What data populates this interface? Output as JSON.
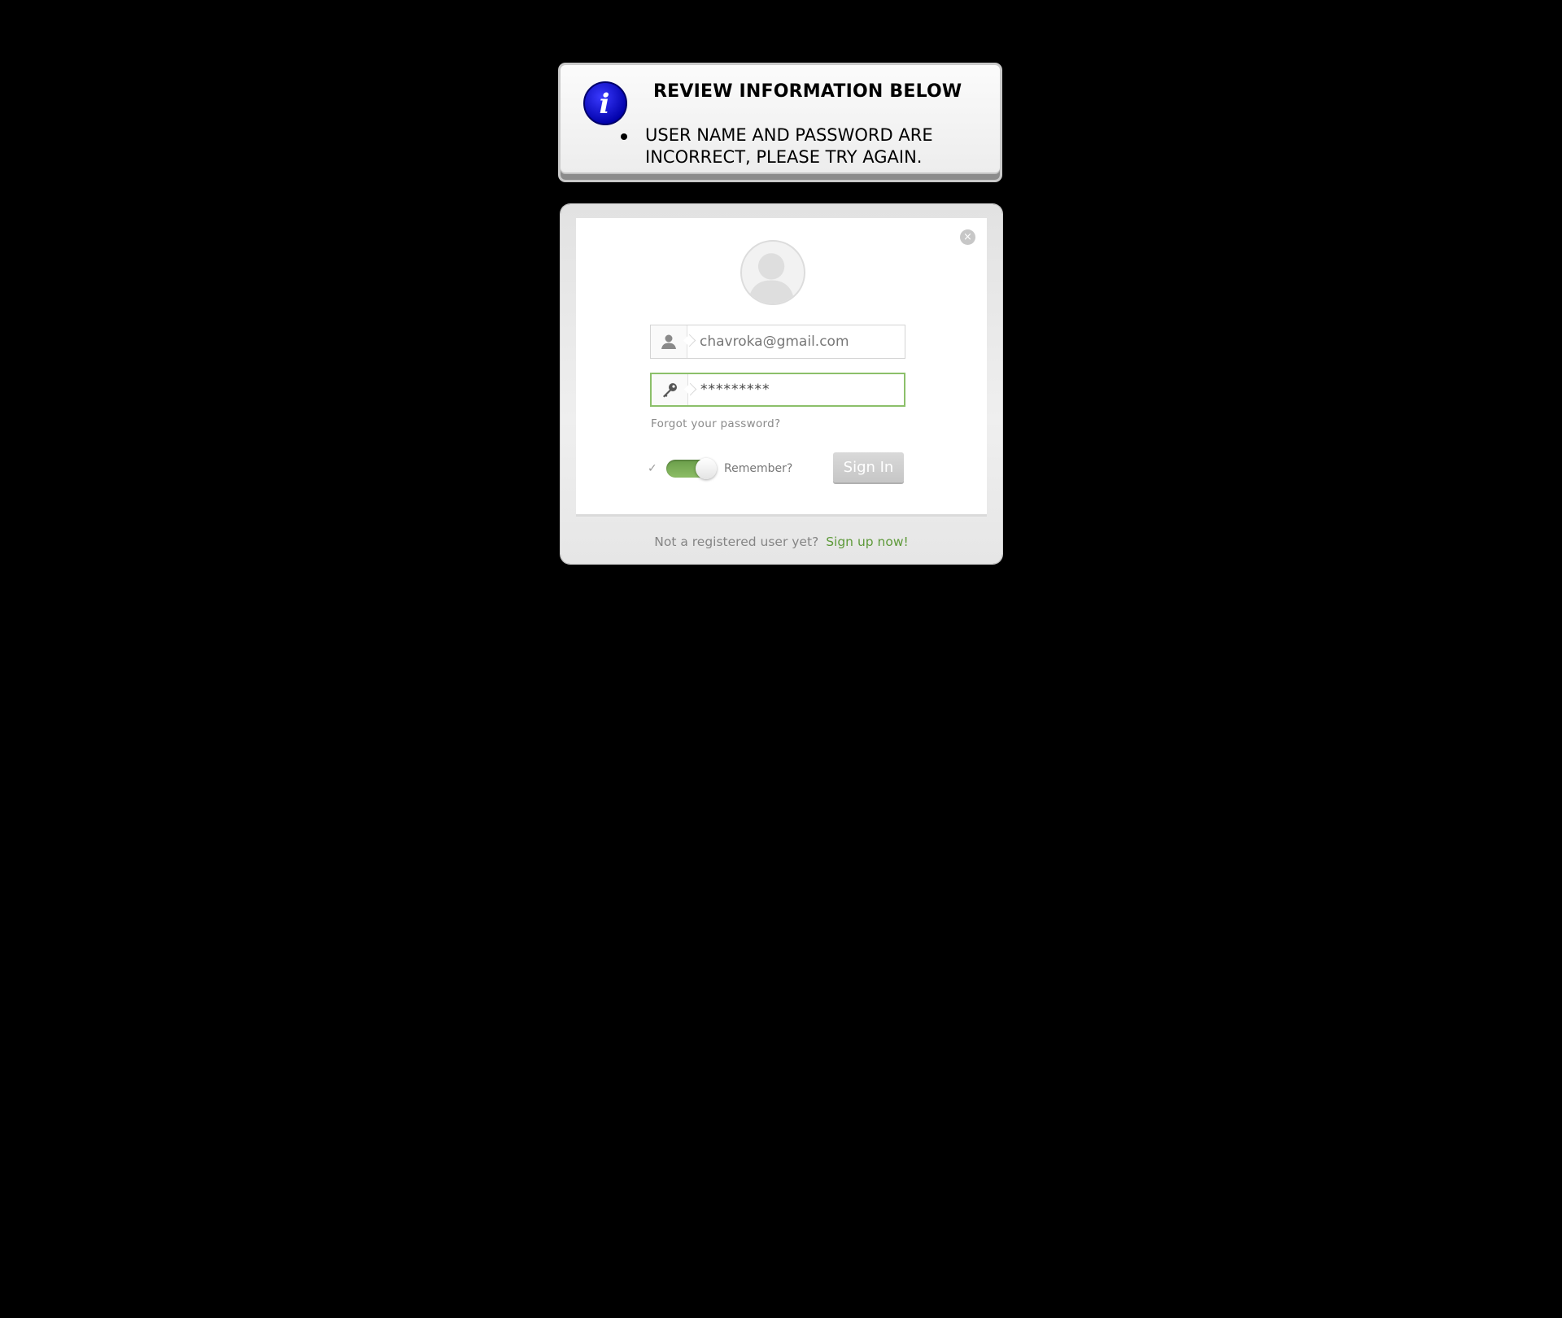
{
  "alert": {
    "title": "REVIEW INFORMATION BELOW",
    "messages": [
      "USER NAME AND PASSWORD ARE INCORRECT, PLEASE TRY AGAIN."
    ],
    "icon": "info-icon",
    "icon_letter": "i",
    "icon_color": "#1010c8"
  },
  "login": {
    "close_symbol": "×",
    "username": {
      "value": "chavroka@gmail.com",
      "icon": "user-icon"
    },
    "password": {
      "value": "*********",
      "icon": "key-icon"
    },
    "forgot_link": "Forgot your password?",
    "remember": {
      "check_symbol": "✓",
      "label": "Remember?",
      "toggle_on": true
    },
    "sign_in_label": "Sign In",
    "footer": {
      "text": "Not a registered user yet?",
      "link": "Sign up now!"
    },
    "accent_color": "#8cc06a",
    "link_color": "#5e9a3a"
  }
}
